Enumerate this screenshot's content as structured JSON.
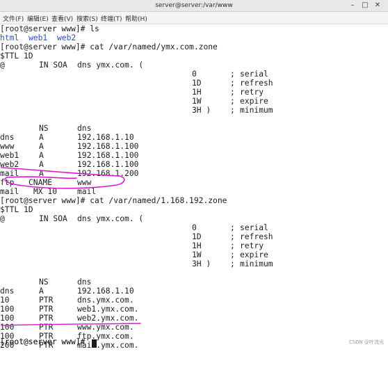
{
  "window": {
    "title": "server@server:/var/www",
    "minimize_glyph": "–",
    "maximize_glyph": "□",
    "close_glyph": "✕"
  },
  "menu": [
    "文件(F)",
    "编辑(E)",
    "查看(V)",
    "搜索(S)",
    "终端(T)",
    "帮助(H)"
  ],
  "terminal": {
    "prompt1": "[root@server www]# ls",
    "ls_output": [
      "html",
      "web1",
      "web2"
    ],
    "prompt2": "[root@server www]# cat /var/named/ymx.com.zone",
    "zone1": {
      "ttl": "$TTL 1D",
      "soa": {
        "c1": "@",
        "c2": "IN SOA",
        "c3": "dns ymx.com. ("
      },
      "serial": {
        "v": "0",
        "semi": ";",
        "label": "serial"
      },
      "refresh": {
        "v": "1D",
        "semi": ";",
        "label": "refresh"
      },
      "retry": {
        "v": "1H",
        "semi": ";",
        "label": "retry"
      },
      "expire": {
        "v": "1W",
        "semi": ";",
        "label": "expire"
      },
      "minimum": {
        "v": "3H )",
        "semi": ";",
        "label": "minimum"
      },
      "records": [
        {
          "name": "",
          "type": "NS",
          "value": "dns"
        },
        {
          "name": "dns",
          "type": "A",
          "value": "192.168.1.10"
        },
        {
          "name": "www",
          "type": "A",
          "value": "192.168.1.100"
        },
        {
          "name": "web1",
          "type": "A",
          "value": "192.168.1.100"
        },
        {
          "name": "web2",
          "type": "A",
          "value": "192.168.1.100"
        },
        {
          "name": "mail",
          "type": "A",
          "value": "192.168.1.200"
        },
        {
          "name": "ftp",
          "type": "CNAME",
          "value": "www"
        },
        {
          "name": "mail",
          "type": "MX 10",
          "value": "mail"
        }
      ]
    },
    "prompt3": "[root@server www]# cat /var/named/1.168.192.zone",
    "zone2": {
      "ttl": "$TTL 1D",
      "soa": {
        "c1": "@",
        "c2": "IN SOA",
        "c3": "dns ymx.com. ("
      },
      "serial": {
        "v": "0",
        "semi": ";",
        "label": "serial"
      },
      "refresh": {
        "v": "1D",
        "semi": ";",
        "label": "refresh"
      },
      "retry": {
        "v": "1H",
        "semi": ";",
        "label": "retry"
      },
      "expire": {
        "v": "1W",
        "semi": ";",
        "label": "expire"
      },
      "minimum": {
        "v": "3H )",
        "semi": ";",
        "label": "minimum"
      },
      "records": [
        {
          "name": "",
          "type": "NS",
          "value": "dns"
        },
        {
          "name": "dns",
          "type": "A",
          "value": "192.168.1.10"
        },
        {
          "name": "10",
          "type": "PTR",
          "value": "dns.ymx.com."
        },
        {
          "name": "100",
          "type": "PTR",
          "value": "web1.ymx.com."
        },
        {
          "name": "100",
          "type": "PTR",
          "value": "web2.ymx.com."
        },
        {
          "name": "100",
          "type": "PTR",
          "value": "www.ymx.com."
        },
        {
          "name": "100",
          "type": "PTR",
          "value": "ftp.ymx.com."
        },
        {
          "name": "200",
          "type": "PTR",
          "value": "mail.ymx.com."
        }
      ]
    },
    "prompt4": "[root@server www]#"
  },
  "watermark": "CSDN @叶流光",
  "colors": {
    "text": "#1c1c1c",
    "directory": "#2f4ec8",
    "annotation": "#d81ad0"
  }
}
